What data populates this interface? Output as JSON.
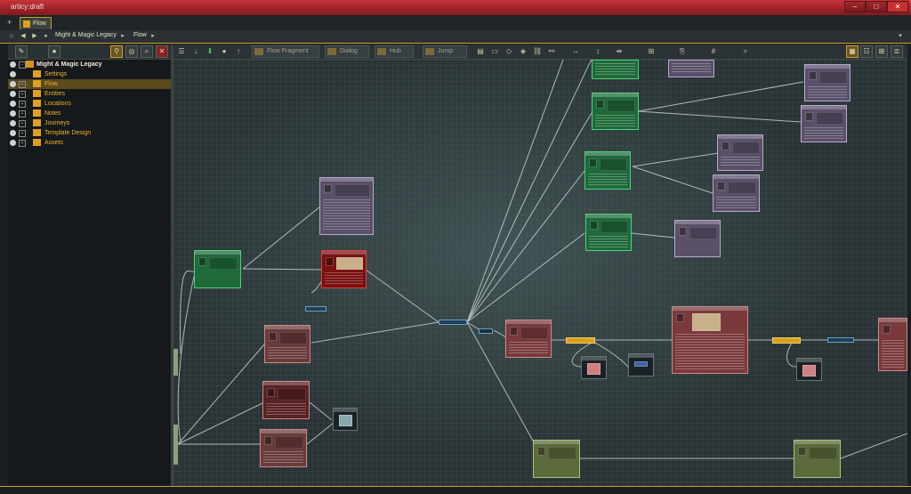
{
  "app": {
    "title": "articy:draft"
  },
  "window_buttons": [
    "–",
    "□",
    "✕"
  ],
  "tabs": [
    {
      "label": "Flow"
    }
  ],
  "breadcrumb": {
    "items": [
      "Might & Magic Legacy",
      "Flow"
    ]
  },
  "tree": {
    "root": "Might & Magic Legacy",
    "items": [
      {
        "label": "Settings"
      },
      {
        "label": "Flow",
        "selected": true
      },
      {
        "label": "Entities"
      },
      {
        "label": "Locations"
      },
      {
        "label": "Notes"
      },
      {
        "label": "Journeys"
      },
      {
        "label": "Template Design"
      },
      {
        "label": "Assets"
      }
    ]
  },
  "flow_toolbar": {
    "flow_fragment": "Flow Fragment",
    "dialog": "Dialog",
    "hub": "Hub",
    "jump": "Jump"
  },
  "colors": {
    "accent": "#c8a030",
    "node_green": "#1f6a3a",
    "node_purple": "#5a5068",
    "node_red": "#7a1010",
    "node_rose": "#6a3a3c",
    "node_olive": "#5c6a3c"
  },
  "icons": {
    "home": "home-icon",
    "back": "back-arrow-icon",
    "forward": "forward-arrow-icon",
    "search": "search-icon",
    "zoom": "zoom-icon"
  }
}
